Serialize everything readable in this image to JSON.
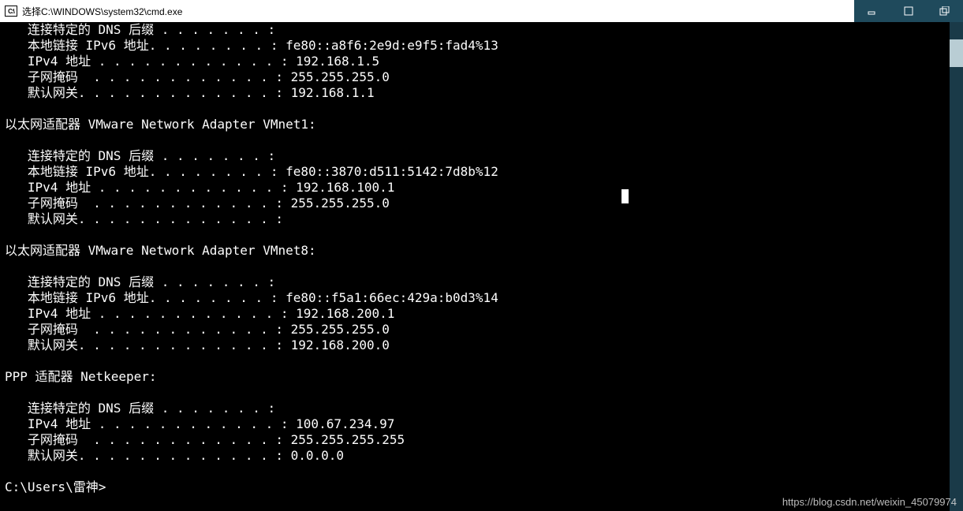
{
  "title": "选择C:\\WINDOWS\\system32\\cmd.exe",
  "icon_label": "C:\\",
  "adapters": [
    {
      "header": null,
      "lines": [
        {
          "label": "   连接特定的 DNS 后缀 . . . . . . . :",
          "value": ""
        },
        {
          "label": "   本地链接 IPv6 地址. . . . . . . . :",
          "value": " fe80::a8f6:2e9d:e9f5:fad4%13"
        },
        {
          "label": "   IPv4 地址 . . . . . . . . . . . . :",
          "value": " 192.168.1.5"
        },
        {
          "label": "   子网掩码  . . . . . . . . . . . . :",
          "value": " 255.255.255.0"
        },
        {
          "label": "   默认网关. . . . . . . . . . . . . :",
          "value": " 192.168.1.1"
        }
      ]
    },
    {
      "header": "以太网适配器 VMware Network Adapter VMnet1:",
      "lines": [
        {
          "label": "   连接特定的 DNS 后缀 . . . . . . . :",
          "value": ""
        },
        {
          "label": "   本地链接 IPv6 地址. . . . . . . . :",
          "value": " fe80::3870:d511:5142:7d8b%12"
        },
        {
          "label": "   IPv4 地址 . . . . . . . . . . . . :",
          "value": " 192.168.100.1"
        },
        {
          "label": "   子网掩码  . . . . . . . . . . . . :",
          "value": " 255.255.255.0"
        },
        {
          "label": "   默认网关. . . . . . . . . . . . . :",
          "value": ""
        }
      ]
    },
    {
      "header": "以太网适配器 VMware Network Adapter VMnet8:",
      "lines": [
        {
          "label": "   连接特定的 DNS 后缀 . . . . . . . :",
          "value": ""
        },
        {
          "label": "   本地链接 IPv6 地址. . . . . . . . :",
          "value": " fe80::f5a1:66ec:429a:b0d3%14"
        },
        {
          "label": "   IPv4 地址 . . . . . . . . . . . . :",
          "value": " 192.168.200.1"
        },
        {
          "label": "   子网掩码  . . . . . . . . . . . . :",
          "value": " 255.255.255.0"
        },
        {
          "label": "   默认网关. . . . . . . . . . . . . :",
          "value": " 192.168.200.0"
        }
      ]
    },
    {
      "header": "PPP 适配器 Netkeeper:",
      "lines": [
        {
          "label": "   连接特定的 DNS 后缀 . . . . . . . :",
          "value": ""
        },
        {
          "label": "   IPv4 地址 . . . . . . . . . . . . :",
          "value": " 100.67.234.97"
        },
        {
          "label": "   子网掩码  . . . . . . . . . . . . :",
          "value": " 255.255.255.255"
        },
        {
          "label": "   默认网关. . . . . . . . . . . . . :",
          "value": " 0.0.0.0"
        }
      ]
    }
  ],
  "prompt": "C:\\Users\\雷神>",
  "watermark": "https://blog.csdn.net/weixin_45079974"
}
